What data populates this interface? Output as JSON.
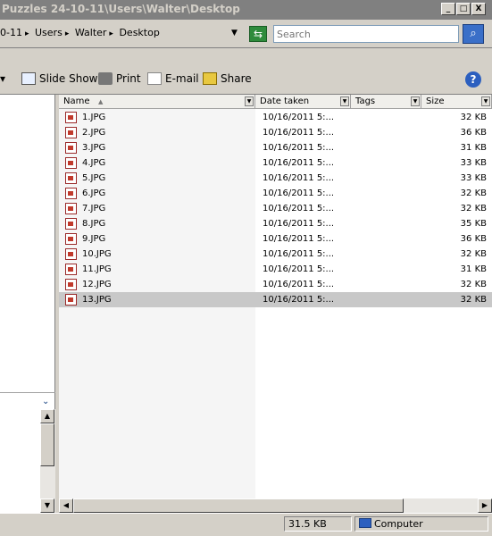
{
  "window": {
    "title": "Puzzles 24-10-11\\Users\\Walter\\Desktop",
    "minimize_glyph": "_",
    "maximize_glyph": "□",
    "close_glyph": "X"
  },
  "address": {
    "breadcrumb": [
      "0-11",
      "Users",
      "Walter",
      "Desktop"
    ],
    "separator": "▸",
    "search_placeholder": "Search"
  },
  "toolbar": {
    "items": [
      {
        "label": "Slide Show",
        "icon": "slideshow-icon"
      },
      {
        "label": "Print",
        "icon": "printer-icon"
      },
      {
        "label": "E-mail",
        "icon": "email-icon"
      },
      {
        "label": "Share",
        "icon": "share-icon"
      }
    ],
    "help": "?"
  },
  "columns": {
    "name": "Name",
    "date": "Date taken",
    "tags": "Tags",
    "size": "Size"
  },
  "files": [
    {
      "name": "1.JPG",
      "date": "10/16/2011 5:...",
      "size": "32 KB"
    },
    {
      "name": "2.JPG",
      "date": "10/16/2011 5:...",
      "size": "36 KB"
    },
    {
      "name": "3.JPG",
      "date": "10/16/2011 5:...",
      "size": "31 KB"
    },
    {
      "name": "4.JPG",
      "date": "10/16/2011 5:...",
      "size": "33 KB"
    },
    {
      "name": "5.JPG",
      "date": "10/16/2011 5:...",
      "size": "33 KB"
    },
    {
      "name": "6.JPG",
      "date": "10/16/2011 5:...",
      "size": "32 KB"
    },
    {
      "name": "7.JPG",
      "date": "10/16/2011 5:...",
      "size": "32 KB"
    },
    {
      "name": "8.JPG",
      "date": "10/16/2011 5:...",
      "size": "35 KB"
    },
    {
      "name": "9.JPG",
      "date": "10/16/2011 5:...",
      "size": "36 KB"
    },
    {
      "name": "10.JPG",
      "date": "10/16/2011 5:...",
      "size": "32 KB"
    },
    {
      "name": "11.JPG",
      "date": "10/16/2011 5:...",
      "size": "31 KB"
    },
    {
      "name": "12.JPG",
      "date": "10/16/2011 5:...",
      "size": "32 KB"
    },
    {
      "name": "13.JPG",
      "date": "10/16/2011 5:...",
      "size": "32 KB",
      "selected": true
    }
  ],
  "status": {
    "size": "31.5 KB",
    "location": "Computer"
  },
  "colors": {
    "selected_row": "#c8c8c8",
    "accent": "#2c5fbf"
  }
}
